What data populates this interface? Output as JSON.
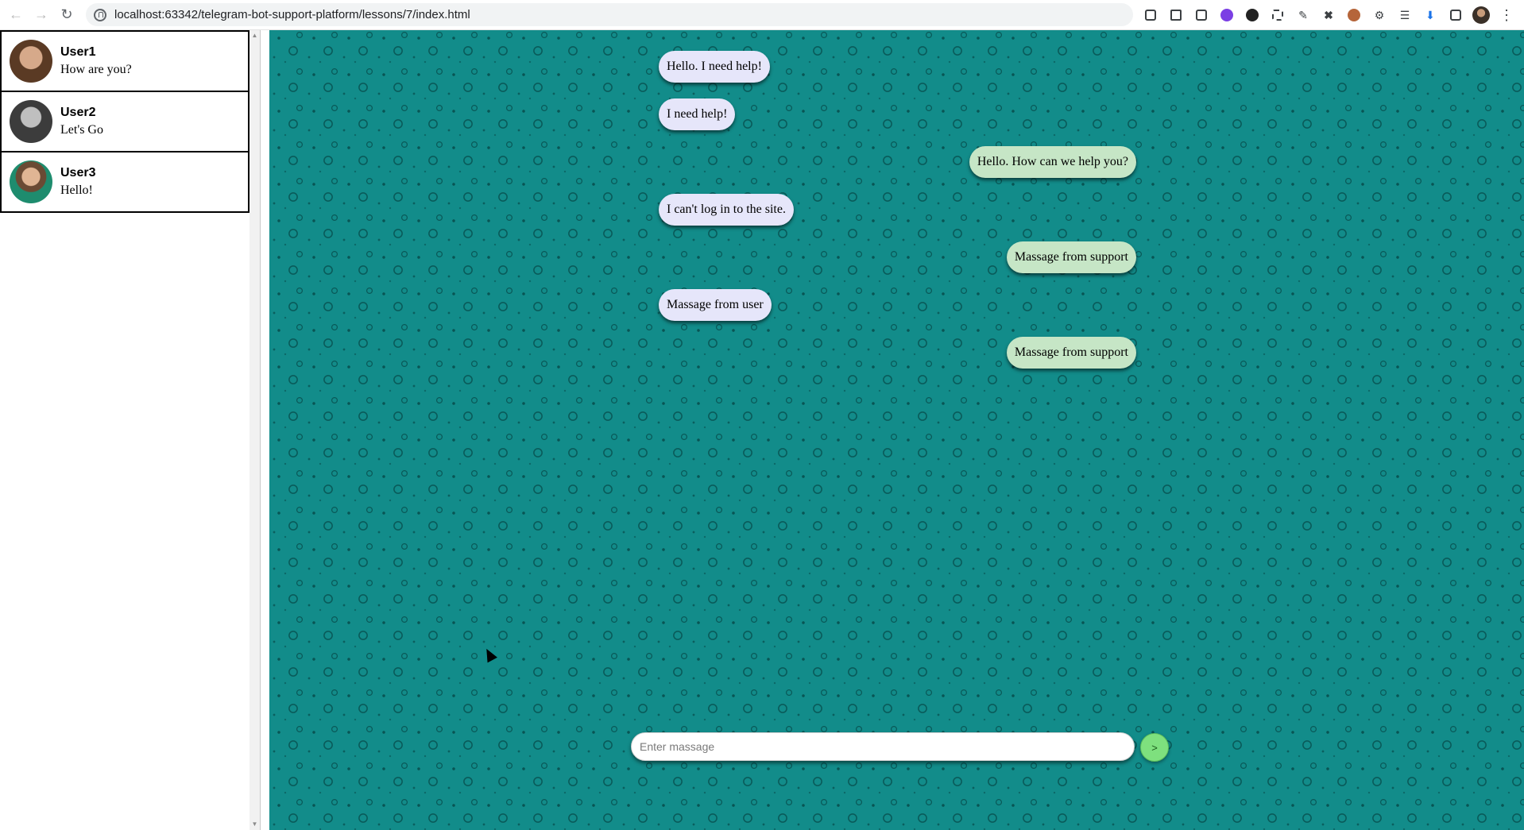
{
  "browser": {
    "url": "localhost:63342/telegram-bot-support-platform/lessons/7/index.html",
    "back_icon": "arrow-left-icon",
    "forward_icon": "arrow-right-icon",
    "reload_icon": "reload-icon"
  },
  "sidebar": {
    "chats": [
      {
        "name": "User1",
        "last_message": "How are you?"
      },
      {
        "name": "User2",
        "last_message": "Let's Go"
      },
      {
        "name": "User3",
        "last_message": "Hello!"
      }
    ]
  },
  "chat": {
    "messages": [
      {
        "from": "user",
        "text": "Hello. I need help!"
      },
      {
        "from": "user",
        "text": "I need help!"
      },
      {
        "from": "support",
        "text": "Hello. How can we help you?"
      },
      {
        "from": "user",
        "text": "I can't log in to the site."
      },
      {
        "from": "support",
        "text": "Massage from support"
      },
      {
        "from": "user",
        "text": "Massage from user"
      },
      {
        "from": "support",
        "text": "Massage from support"
      }
    ],
    "input_placeholder": "Enter massage",
    "send_label": ">"
  },
  "colors": {
    "chat_background": "#128c8a",
    "user_bubble": "#e6e6fa",
    "support_bubble": "#c6e6c6",
    "send_button": "#7ee07e"
  }
}
